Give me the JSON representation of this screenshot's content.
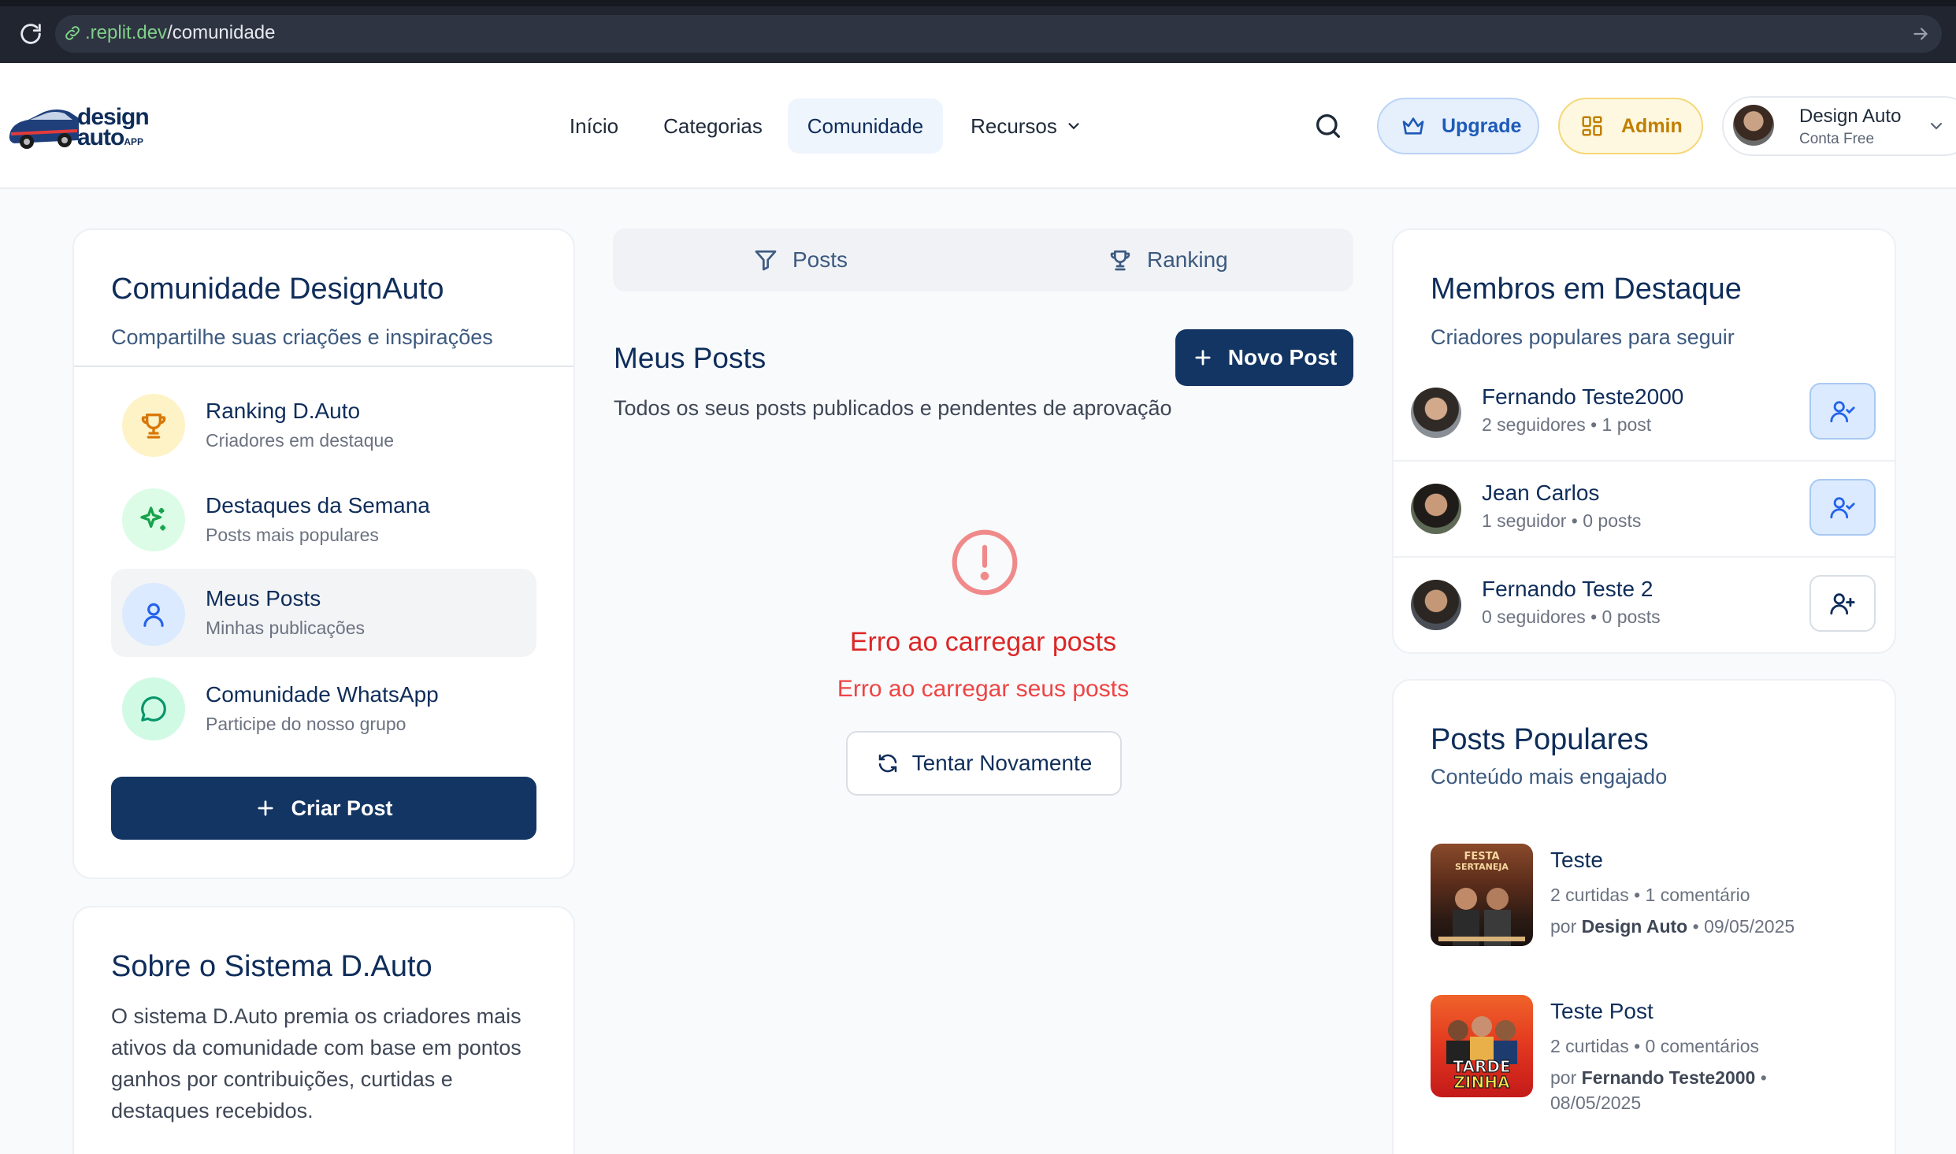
{
  "browser": {
    "url_host": ".replit.dev",
    "url_path": "/comunidade"
  },
  "header": {
    "logo_line1": "design",
    "logo_line2": "auto",
    "logo_sub": "APP",
    "nav": {
      "inicio": "Início",
      "categorias": "Categorias",
      "comunidade": "Comunidade",
      "recursos": "Recursos"
    },
    "upgrade_label": "Upgrade",
    "admin_label": "Admin",
    "user_name": "Design Auto",
    "user_plan": "Conta Free"
  },
  "sidebar": {
    "title": "Comunidade DesignAuto",
    "subtitle": "Compartilhe suas criações e inspirações",
    "items": [
      {
        "title": "Ranking D.Auto",
        "desc": "Criadores em destaque"
      },
      {
        "title": "Destaques da Semana",
        "desc": "Posts mais populares"
      },
      {
        "title": "Meus Posts",
        "desc": "Minhas publicações"
      },
      {
        "title": "Comunidade WhatsApp",
        "desc": "Participe do nosso grupo"
      }
    ],
    "create_label": "Criar Post"
  },
  "about": {
    "title": "Sobre o Sistema D.Auto",
    "text": "O sistema D.Auto premia os criadores mais ativos da comunidade com base em pontos ganhos por contribuições, curtidas e destaques recebidos."
  },
  "main": {
    "tabs": {
      "posts": "Posts",
      "ranking": "Ranking"
    },
    "title": "Meus Posts",
    "subtitle": "Todos os seus posts publicados e pendentes de aprovação",
    "new_post_label": "Novo Post",
    "error_title": "Erro ao carregar posts",
    "error_subtitle": "Erro ao carregar seus posts",
    "retry_label": "Tentar Novamente"
  },
  "members": {
    "title": "Membros em Destaque",
    "subtitle": "Criadores populares para seguir",
    "list": [
      {
        "name": "Fernando Teste2000",
        "meta": "2 seguidores • 1 post",
        "following": true
      },
      {
        "name": "Jean Carlos",
        "meta": "1 seguidor • 0 posts",
        "following": true
      },
      {
        "name": "Fernando Teste 2",
        "meta": "0 seguidores • 0 posts",
        "following": false
      }
    ]
  },
  "popular": {
    "title": "Posts Populares",
    "subtitle": "Conteúdo mais engajado",
    "posts": [
      {
        "title": "Teste",
        "stats": "2 curtidas • 1 comentário",
        "by": "por",
        "author": "Design Auto",
        "date": "• 09/05/2025",
        "thumb_text": "FESTA SERTANEJA"
      },
      {
        "title": "Teste Post",
        "stats": "2 curtidas • 0 comentários",
        "by": "por",
        "author": "Fernando Teste2000",
        "date": "•",
        "date2": "08/05/2025",
        "thumb_text": "TARDE ZINHA"
      }
    ]
  },
  "colors": {
    "primary": "#133563",
    "error": "#dc2626",
    "upgrade": "#1e5ab8",
    "admin": "#c07f00"
  }
}
